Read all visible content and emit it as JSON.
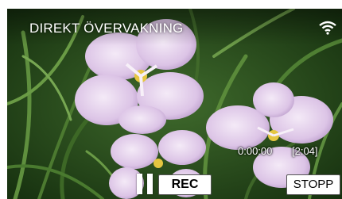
{
  "screen": {
    "title": "DIREKT ÖVERVAKNING",
    "status_icon": "wifi-icon"
  },
  "timer": {
    "elapsed": "0:00:00",
    "remaining": "[2:04]"
  },
  "controls": {
    "pause_icon": "pause-icon",
    "rec_label": "REC",
    "stop_label": "STOPP"
  },
  "colors": {
    "overlay_text": "#ffffff",
    "button_bg": "#ffffff",
    "button_text": "#000000"
  }
}
